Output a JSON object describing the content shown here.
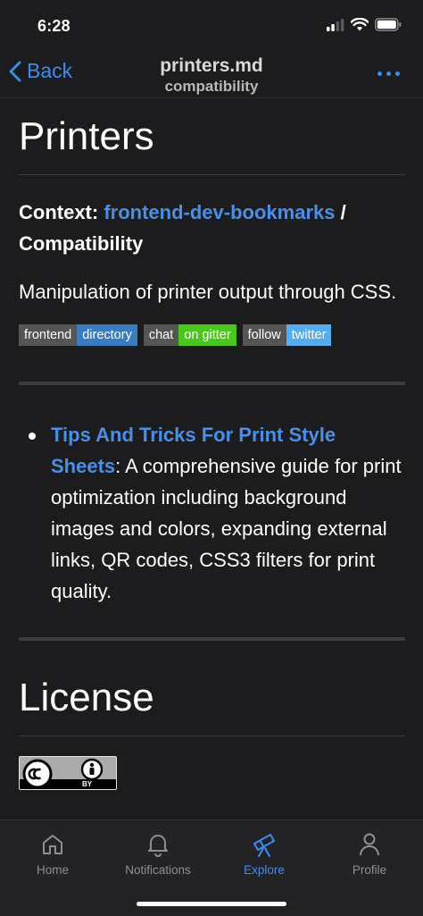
{
  "status": {
    "time": "6:28"
  },
  "nav": {
    "back_label": "Back",
    "title": "printers.md",
    "subtitle": "compatibility"
  },
  "doc": {
    "heading": "Printers",
    "context_label": "Context:",
    "context_link": "frontend-dev-bookmarks",
    "context_sep": " /",
    "context_section": "Compatibility",
    "description": "Manipulation of printer output through CSS.",
    "badges": [
      {
        "left": "frontend",
        "right": "directory",
        "color": "#3b7bbf"
      },
      {
        "left": "chat",
        "right": "on gitter",
        "color": "#4cc61e"
      },
      {
        "left": "follow",
        "right": "twitter",
        "color": "#55acee"
      }
    ],
    "items": [
      {
        "link": "Tips And Tricks For Print Style Sheets",
        "text": ": A comprehensive guide for print optimization including background images and colors, expanding external links, QR codes, CSS3 filters for print quality."
      }
    ],
    "license_heading": "License",
    "cc_badge_text": "BY"
  },
  "tabs": [
    {
      "label": "Home",
      "icon": "home-icon",
      "active": false
    },
    {
      "label": "Notifications",
      "icon": "bell-icon",
      "active": false
    },
    {
      "label": "Explore",
      "icon": "telescope-icon",
      "active": true
    },
    {
      "label": "Profile",
      "icon": "person-icon",
      "active": false
    }
  ],
  "colors": {
    "accent": "#3a8cf0",
    "link": "#4a8fe6",
    "background": "#1c1c1e"
  }
}
